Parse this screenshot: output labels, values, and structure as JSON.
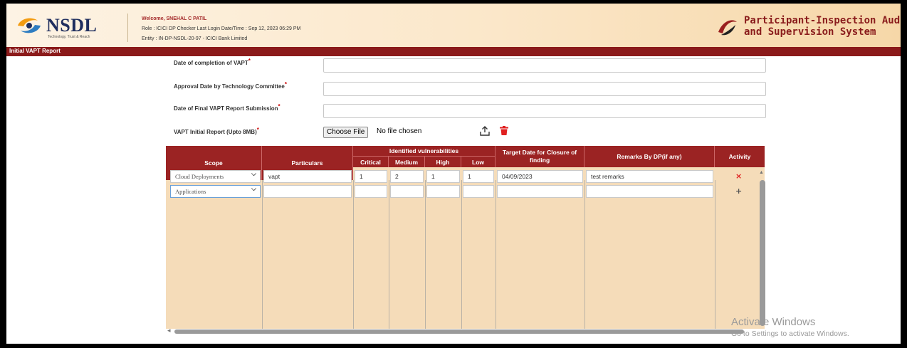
{
  "header": {
    "logo_text": "NSDL",
    "logo_tagline": "Technology, Trust & Reach",
    "welcome_label": "Welcome,",
    "user_name": "SNEHAL C PATIL",
    "role_line": "Role : ICICI DP Checker   Last Login Date/Time : Sep 12, 2023 06:29 PM",
    "entity_line": "Entity : IN-DP-NSDL-20-97 - ICICI Bank Limited",
    "brand_line1": "Participant-Inspection Audit",
    "brand_line2": "and Supervision System"
  },
  "page_title": "Initial VAPT Report",
  "form": {
    "completion_label": "Date of completion of VAPT",
    "approval_label": "Approval Date by Technology Committee",
    "submission_label": "Date of Final VAPT Report Submission",
    "report_label": "VAPT Initial Report (Upto 8MB)",
    "required_mark": "*",
    "choose_file_label": "Choose File",
    "no_file_text": "No file chosen"
  },
  "table": {
    "headers": {
      "scope": "Scope",
      "particulars": "Particulars",
      "vulnerabilities": "Identified vulnerabilities",
      "critical": "Critical",
      "medium": "Medium",
      "high": "High",
      "low": "Low",
      "target_date": "Target Date for Closure of finding",
      "remarks": "Remarks By DP(if any)",
      "activity": "Activity"
    },
    "rows": [
      {
        "scope": "Cloud Deployments",
        "particulars": "vapt",
        "critical": "1",
        "medium": "2",
        "high": "1",
        "low": "1",
        "target_date": "04/09/2023",
        "remarks": "test remarks",
        "action": "×"
      },
      {
        "scope": "Applications",
        "particulars": "",
        "critical": "",
        "medium": "",
        "high": "",
        "low": "",
        "target_date": "",
        "remarks": "",
        "action": "+"
      }
    ]
  },
  "watermark": {
    "line1": "Activate Windows",
    "line2": "Go to Settings to activate Windows."
  },
  "colors": {
    "header_bar": "#8b1a1a",
    "table_header": "#9b2323",
    "table_body": "#f5dcb9",
    "delete_red": "#e02020"
  }
}
